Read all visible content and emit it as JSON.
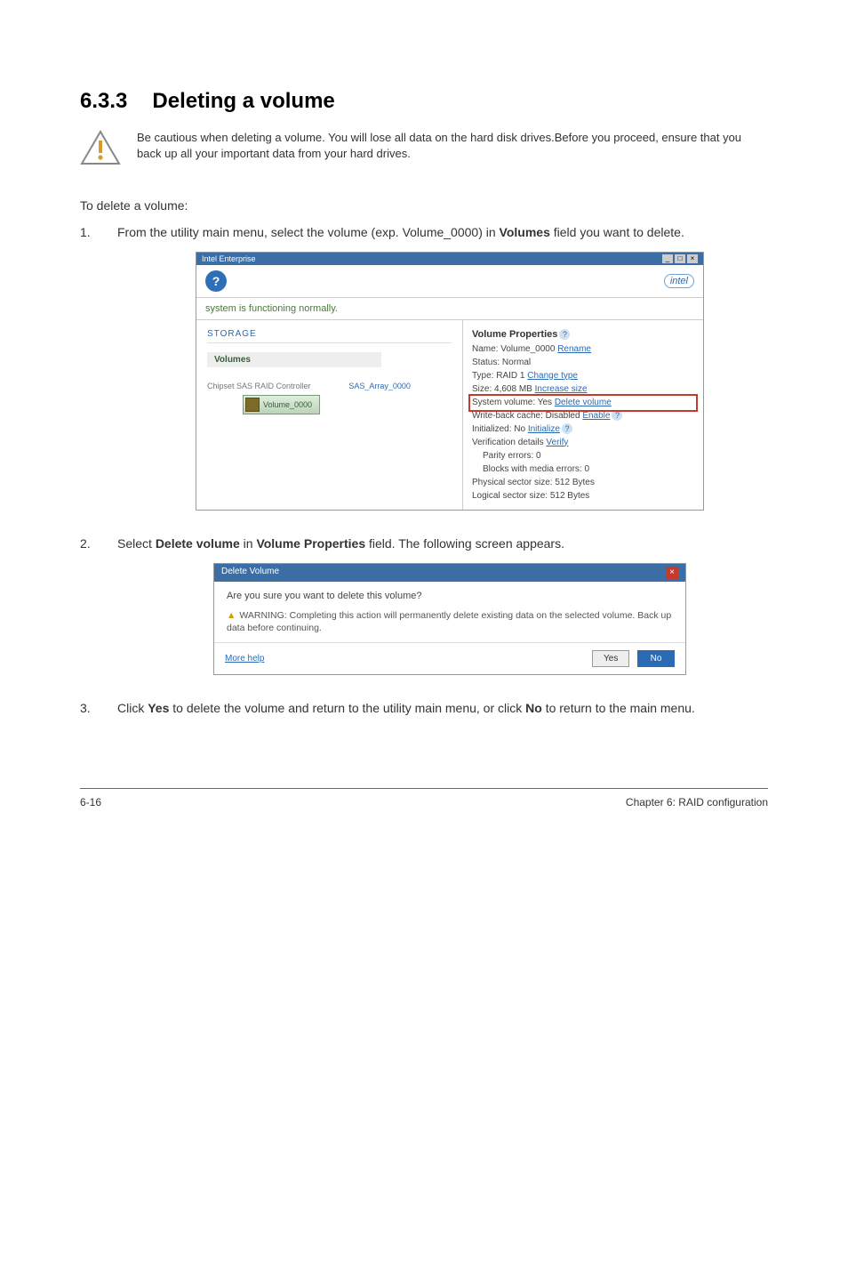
{
  "heading": {
    "number": "6.3.3",
    "title": "Deleting a volume"
  },
  "caution": "Be cautious when deleting a volume. You will lose all data on the hard disk drives.Before you proceed, ensure that you back up all your important data from your hard drives.",
  "intro": "To delete a volume:",
  "step1": {
    "num": "1.",
    "pre": "From the utility main menu, select the volume (exp. Volume_0000) in ",
    "bold": "Volumes",
    "post": " field you want to delete."
  },
  "screenshot1": {
    "titlebar": "Intel Enterprise",
    "help_icon": "?",
    "intel_logo": "intel",
    "status": "system is functioning normally.",
    "breadcrumb": "STORAGE",
    "volumes_header": "Volumes",
    "controller": "Chipset SAS RAID Controller",
    "array": "SAS_Array_0000",
    "volume_chip": "Volume_0000",
    "props": {
      "title": "Volume Properties",
      "name_label": "Name:",
      "name_value": "Volume_0000",
      "rename": "Rename",
      "status_label": "Status:",
      "status_value": "Normal",
      "type_label": "Type:",
      "type_value": "RAID 1",
      "change_type": "Change type",
      "size_label": "Size:",
      "size_value": "4,608 MB",
      "increase_size": "Increase size",
      "sys_vol": "System volume: Yes",
      "delete_volume": "Delete volume",
      "wb_cache": "Write-back cache: Disabled",
      "enable": "Enable",
      "initialized": "Initialized: No",
      "initialize": "Initialize",
      "verify_details": "Verification details",
      "verify": "Verify",
      "parity": "Parity errors: 0",
      "blocks": "Blocks with media errors: 0",
      "phys_sector": "Physical sector size: 512 Bytes",
      "log_sector": "Logical sector size: 512 Bytes"
    }
  },
  "step2": {
    "num": "2.",
    "a": "Select ",
    "b1": "Delete volume",
    "c": " in ",
    "b2": "Volume Properties",
    "d": " field. The following screen appears."
  },
  "screenshot2": {
    "title": "Delete Volume",
    "question": "Are you sure you want to delete this volume?",
    "warning_label": "WARNING:",
    "warning_text": " Completing this action will permanently delete existing data on the selected volume. Back up data before continuing.",
    "more_help": "More help",
    "yes": "Yes",
    "no": "No"
  },
  "step3": {
    "num": "3.",
    "a": "Click ",
    "b1": "Yes",
    "c": " to delete the volume and return to the utility main menu, or click ",
    "b2": "No",
    "d": " to return to the main menu."
  },
  "footer": {
    "left": "6-16",
    "right": "Chapter 6: RAID configuration"
  }
}
